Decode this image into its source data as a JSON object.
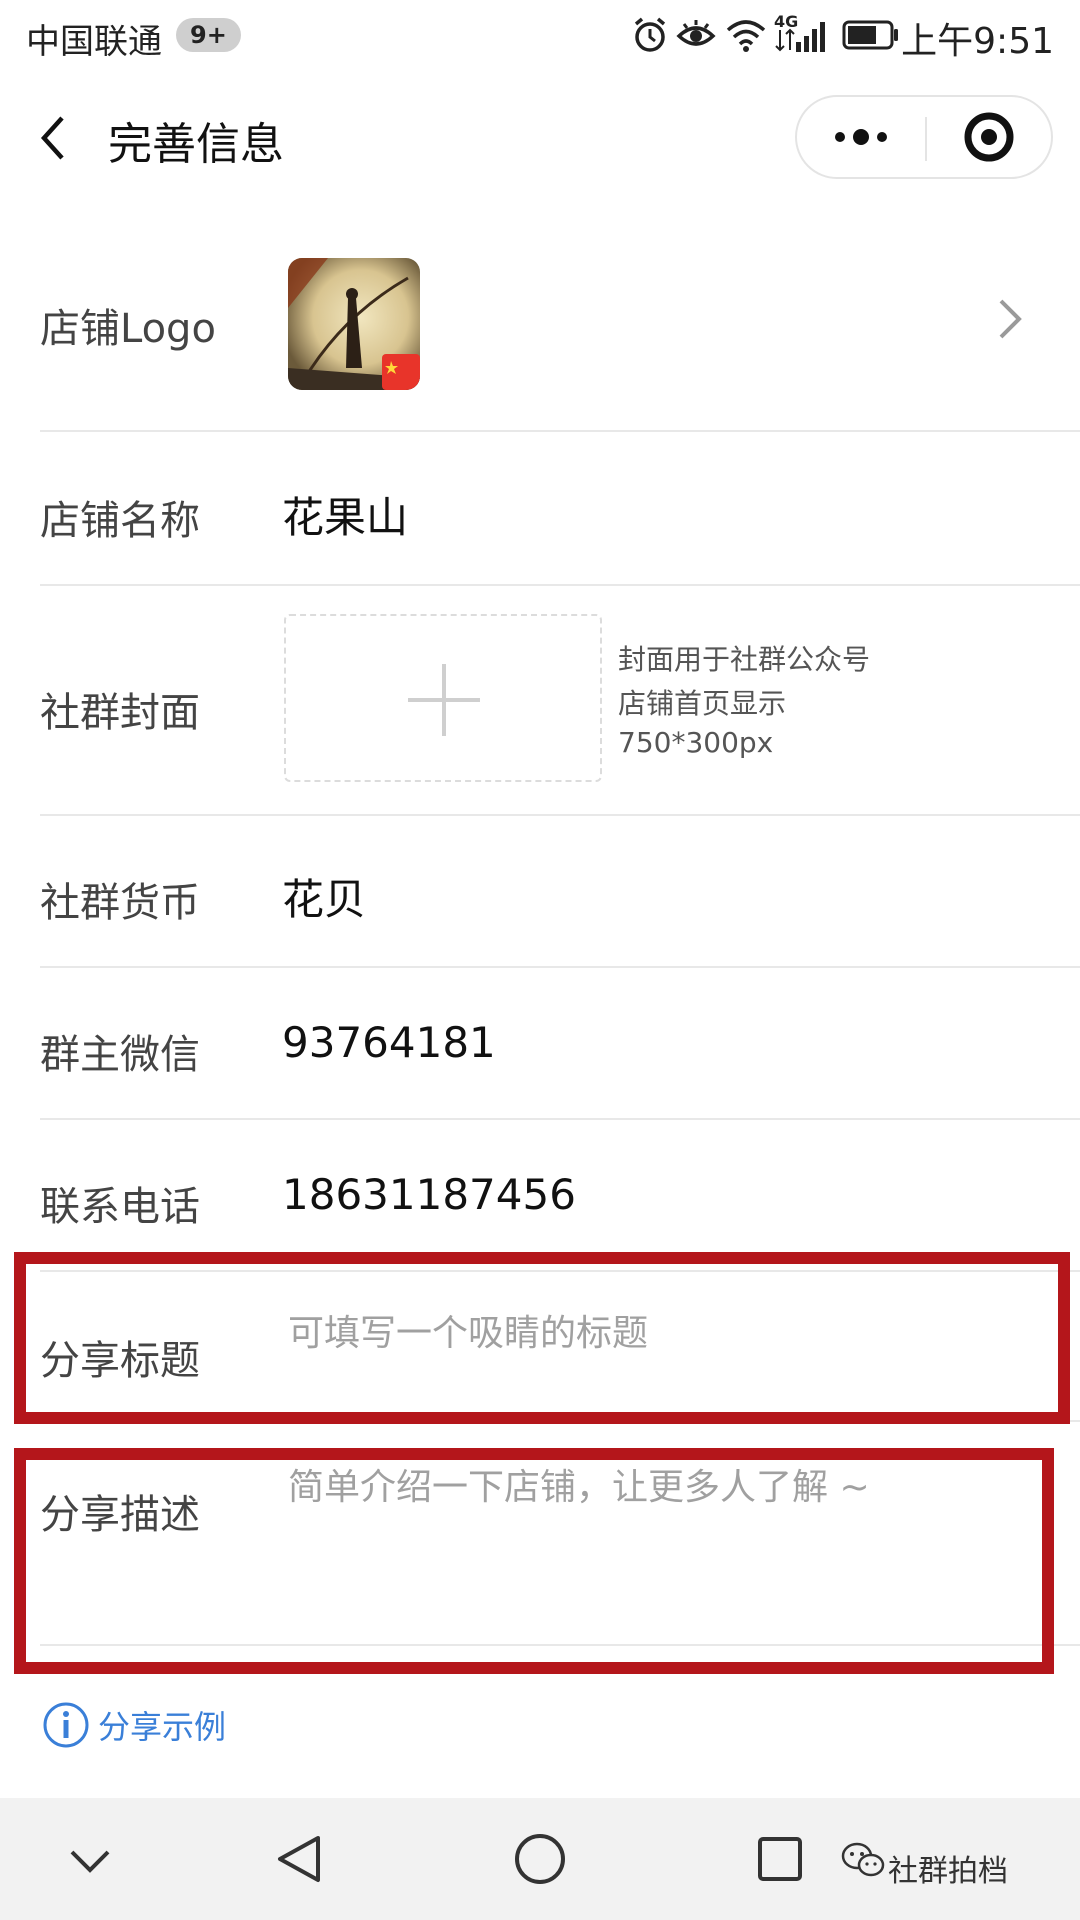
{
  "status_bar": {
    "carrier": "中国联通",
    "badge": "9+",
    "time": "上午9:51",
    "network": "4G"
  },
  "header": {
    "title": "完善信息"
  },
  "form": {
    "logo_label": "店铺Logo",
    "name_label": "店铺名称",
    "name_value": "花果山",
    "cover_label": "社群封面",
    "cover_hint": [
      "封面用于社群公众号",
      "店铺首页显示",
      "750*300px"
    ],
    "currency_label": "社群货币",
    "currency_value": "花贝",
    "wechat_label": "群主微信",
    "wechat_value": "93764181",
    "phone_label": "联系电话",
    "phone_value": "18631187456",
    "share_title_label": "分享标题",
    "share_title_placeholder": "可填写一个吸睛的标题",
    "share_desc_label": "分享描述",
    "share_desc_placeholder": "简单介绍一下店铺，让更多人了解 ~",
    "share_example_link": "分享示例"
  },
  "watermark": "社群拍档",
  "colors": {
    "highlight": "#b4161b",
    "link": "#3a7fd8",
    "navbar_bg": "#f2f2f2"
  },
  "icons": [
    "clock-icon",
    "eye-icon",
    "wifi-icon",
    "signal-icon",
    "battery-icon",
    "back-arrow-icon",
    "more-dots-icon",
    "target-close-icon",
    "chevron-right-icon",
    "plus-icon",
    "info-icon",
    "nav-down-icon",
    "nav-back-icon",
    "nav-home-icon",
    "nav-recent-icon",
    "wechat-icon"
  ]
}
